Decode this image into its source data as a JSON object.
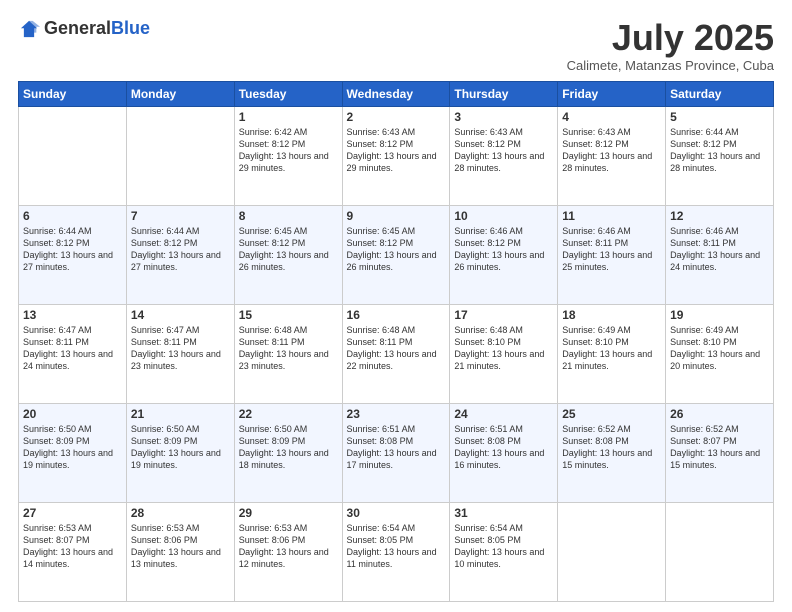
{
  "logo": {
    "general": "General",
    "blue": "Blue"
  },
  "header": {
    "month": "July 2025",
    "location": "Calimete, Matanzas Province, Cuba"
  },
  "days_of_week": [
    "Sunday",
    "Monday",
    "Tuesday",
    "Wednesday",
    "Thursday",
    "Friday",
    "Saturday"
  ],
  "weeks": [
    [
      {
        "day": "",
        "info": ""
      },
      {
        "day": "",
        "info": ""
      },
      {
        "day": "1",
        "info": "Sunrise: 6:42 AM\nSunset: 8:12 PM\nDaylight: 13 hours and 29 minutes."
      },
      {
        "day": "2",
        "info": "Sunrise: 6:43 AM\nSunset: 8:12 PM\nDaylight: 13 hours and 29 minutes."
      },
      {
        "day": "3",
        "info": "Sunrise: 6:43 AM\nSunset: 8:12 PM\nDaylight: 13 hours and 28 minutes."
      },
      {
        "day": "4",
        "info": "Sunrise: 6:43 AM\nSunset: 8:12 PM\nDaylight: 13 hours and 28 minutes."
      },
      {
        "day": "5",
        "info": "Sunrise: 6:44 AM\nSunset: 8:12 PM\nDaylight: 13 hours and 28 minutes."
      }
    ],
    [
      {
        "day": "6",
        "info": "Sunrise: 6:44 AM\nSunset: 8:12 PM\nDaylight: 13 hours and 27 minutes."
      },
      {
        "day": "7",
        "info": "Sunrise: 6:44 AM\nSunset: 8:12 PM\nDaylight: 13 hours and 27 minutes."
      },
      {
        "day": "8",
        "info": "Sunrise: 6:45 AM\nSunset: 8:12 PM\nDaylight: 13 hours and 26 minutes."
      },
      {
        "day": "9",
        "info": "Sunrise: 6:45 AM\nSunset: 8:12 PM\nDaylight: 13 hours and 26 minutes."
      },
      {
        "day": "10",
        "info": "Sunrise: 6:46 AM\nSunset: 8:12 PM\nDaylight: 13 hours and 26 minutes."
      },
      {
        "day": "11",
        "info": "Sunrise: 6:46 AM\nSunset: 8:11 PM\nDaylight: 13 hours and 25 minutes."
      },
      {
        "day": "12",
        "info": "Sunrise: 6:46 AM\nSunset: 8:11 PM\nDaylight: 13 hours and 24 minutes."
      }
    ],
    [
      {
        "day": "13",
        "info": "Sunrise: 6:47 AM\nSunset: 8:11 PM\nDaylight: 13 hours and 24 minutes."
      },
      {
        "day": "14",
        "info": "Sunrise: 6:47 AM\nSunset: 8:11 PM\nDaylight: 13 hours and 23 minutes."
      },
      {
        "day": "15",
        "info": "Sunrise: 6:48 AM\nSunset: 8:11 PM\nDaylight: 13 hours and 23 minutes."
      },
      {
        "day": "16",
        "info": "Sunrise: 6:48 AM\nSunset: 8:11 PM\nDaylight: 13 hours and 22 minutes."
      },
      {
        "day": "17",
        "info": "Sunrise: 6:48 AM\nSunset: 8:10 PM\nDaylight: 13 hours and 21 minutes."
      },
      {
        "day": "18",
        "info": "Sunrise: 6:49 AM\nSunset: 8:10 PM\nDaylight: 13 hours and 21 minutes."
      },
      {
        "day": "19",
        "info": "Sunrise: 6:49 AM\nSunset: 8:10 PM\nDaylight: 13 hours and 20 minutes."
      }
    ],
    [
      {
        "day": "20",
        "info": "Sunrise: 6:50 AM\nSunset: 8:09 PM\nDaylight: 13 hours and 19 minutes."
      },
      {
        "day": "21",
        "info": "Sunrise: 6:50 AM\nSunset: 8:09 PM\nDaylight: 13 hours and 19 minutes."
      },
      {
        "day": "22",
        "info": "Sunrise: 6:50 AM\nSunset: 8:09 PM\nDaylight: 13 hours and 18 minutes."
      },
      {
        "day": "23",
        "info": "Sunrise: 6:51 AM\nSunset: 8:08 PM\nDaylight: 13 hours and 17 minutes."
      },
      {
        "day": "24",
        "info": "Sunrise: 6:51 AM\nSunset: 8:08 PM\nDaylight: 13 hours and 16 minutes."
      },
      {
        "day": "25",
        "info": "Sunrise: 6:52 AM\nSunset: 8:08 PM\nDaylight: 13 hours and 15 minutes."
      },
      {
        "day": "26",
        "info": "Sunrise: 6:52 AM\nSunset: 8:07 PM\nDaylight: 13 hours and 15 minutes."
      }
    ],
    [
      {
        "day": "27",
        "info": "Sunrise: 6:53 AM\nSunset: 8:07 PM\nDaylight: 13 hours and 14 minutes."
      },
      {
        "day": "28",
        "info": "Sunrise: 6:53 AM\nSunset: 8:06 PM\nDaylight: 13 hours and 13 minutes."
      },
      {
        "day": "29",
        "info": "Sunrise: 6:53 AM\nSunset: 8:06 PM\nDaylight: 13 hours and 12 minutes."
      },
      {
        "day": "30",
        "info": "Sunrise: 6:54 AM\nSunset: 8:05 PM\nDaylight: 13 hours and 11 minutes."
      },
      {
        "day": "31",
        "info": "Sunrise: 6:54 AM\nSunset: 8:05 PM\nDaylight: 13 hours and 10 minutes."
      },
      {
        "day": "",
        "info": ""
      },
      {
        "day": "",
        "info": ""
      }
    ]
  ]
}
